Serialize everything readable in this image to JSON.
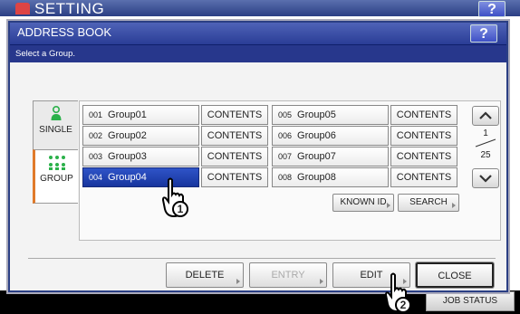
{
  "top_bar": {
    "title": "SETTING",
    "help_label": "?"
  },
  "dialog": {
    "title": "ADDRESS BOOK",
    "help_label": "?",
    "instruction": "Select a Group."
  },
  "tabs": [
    {
      "label": "SINGLE",
      "icon": "person-icon",
      "color": "#2bb14a"
    },
    {
      "label": "GROUP",
      "icon": "group-icon",
      "color": "#2bb14a"
    }
  ],
  "groups_left": [
    {
      "num": "001",
      "name": "Group01",
      "contents": "CONTENTS",
      "selected": false
    },
    {
      "num": "002",
      "name": "Group02",
      "contents": "CONTENTS",
      "selected": false
    },
    {
      "num": "003",
      "name": "Group03",
      "contents": "CONTENTS",
      "selected": false
    },
    {
      "num": "004",
      "name": "Group04",
      "contents": "CONTENTS",
      "selected": true
    }
  ],
  "groups_right": [
    {
      "num": "005",
      "name": "Group05",
      "contents": "CONTENTS"
    },
    {
      "num": "006",
      "name": "Group06",
      "contents": "CONTENTS"
    },
    {
      "num": "007",
      "name": "Group07",
      "contents": "CONTENTS"
    },
    {
      "num": "008",
      "name": "Group08",
      "contents": "CONTENTS"
    }
  ],
  "pager": {
    "current": "1",
    "total": "25"
  },
  "known_id_label": "KNOWN ID",
  "search_label": "SEARCH",
  "actions": {
    "delete": "DELETE",
    "entry": "ENTRY",
    "edit": "EDIT",
    "close": "CLOSE"
  },
  "job_status_label": "JOB STATUS",
  "callouts": [
    "1",
    "2"
  ],
  "colors": {
    "selected_row": "#1f40b0",
    "title_bar": "#2a3d96"
  }
}
